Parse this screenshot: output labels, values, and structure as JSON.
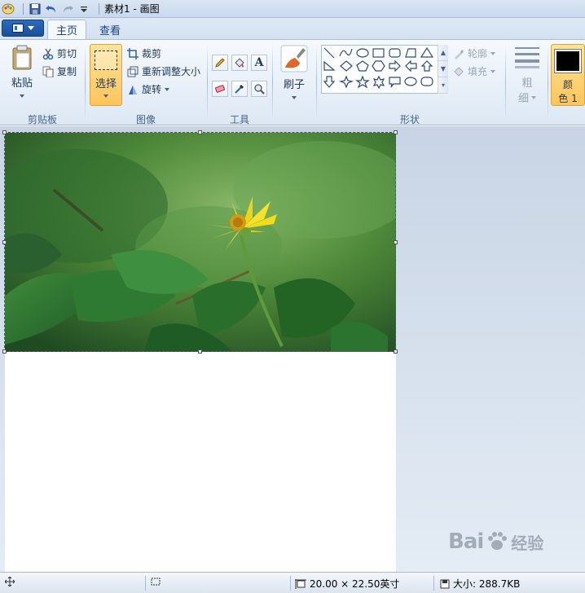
{
  "titlebar": {
    "title": "素材1 - 画图",
    "quick_access": [
      "save-icon",
      "undo-icon",
      "redo-icon",
      "customize-dropdown-icon"
    ]
  },
  "tabs": [
    {
      "label": "主页",
      "active": true
    },
    {
      "label": "查看",
      "active": false
    }
  ],
  "groups": {
    "clipboard": {
      "label": "剪贴板",
      "paste": "粘贴",
      "cut": "剪切",
      "copy": "复制"
    },
    "image": {
      "label": "图像",
      "select": "选择",
      "crop": "裁剪",
      "resize": "重新调整大小",
      "rotate": "旋转"
    },
    "tools": {
      "label": "工具",
      "items": [
        "pencil-icon",
        "fill-bucket-icon",
        "text-icon",
        "eraser-icon",
        "color-picker-icon",
        "magnifier-icon"
      ]
    },
    "brush": {
      "label": "刷子"
    },
    "shapes": {
      "label": "形状",
      "outline": "轮廓",
      "fill": "填充"
    },
    "size": {
      "label_line1": "粗",
      "label_line2": "细"
    },
    "color1": {
      "label_line1": "颜",
      "label_line2": "色 1",
      "value": "#000000"
    }
  },
  "statusbar": {
    "dimensions": "20.00 × 22.50英寸",
    "size": "大小: 288.7KB"
  },
  "watermark": {
    "brand": "Bai",
    "brand_suffix": "经验"
  }
}
